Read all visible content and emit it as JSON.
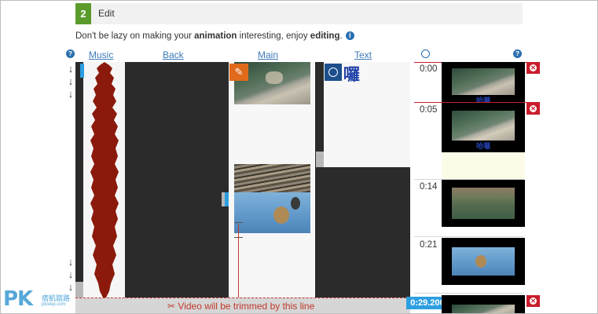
{
  "step": {
    "number": "2",
    "title": "Edit"
  },
  "intro": {
    "part1": "Don't be lazy on making your ",
    "bold1": "animation",
    "part2": " interesting, enjoy ",
    "bold2": "editing",
    "part3": ".",
    "info_icon": "info-icon"
  },
  "columns": {
    "music": "Music",
    "back": "Back",
    "main": "Main",
    "text": "Text"
  },
  "text_track": {
    "clip_text": "囉"
  },
  "timeline": {
    "trim_message": "Video will be trimmed by this line",
    "trim_time": "0:29.200"
  },
  "preview": {
    "frames": [
      {
        "time": "0:00",
        "caption": "哈囉"
      },
      {
        "time": "0:05",
        "caption": "哈囉"
      },
      {
        "time": "0:14",
        "caption": ""
      },
      {
        "time": "0:21",
        "caption": ""
      }
    ]
  },
  "watermark": {
    "logo": "PK",
    "text": "痞凱踏路",
    "subtext": "pkstep.com"
  },
  "colors": {
    "step_badge": "#5b9b2c",
    "link_blue": "#3d7ab8",
    "dark_track": "#2b2b2b",
    "waveform": "#8b1a0c",
    "trim_red": "#c0392b",
    "time_badge": "#2d9ee0",
    "pin_badge": "#e06a1c",
    "delete_red": "#c91d2c"
  }
}
